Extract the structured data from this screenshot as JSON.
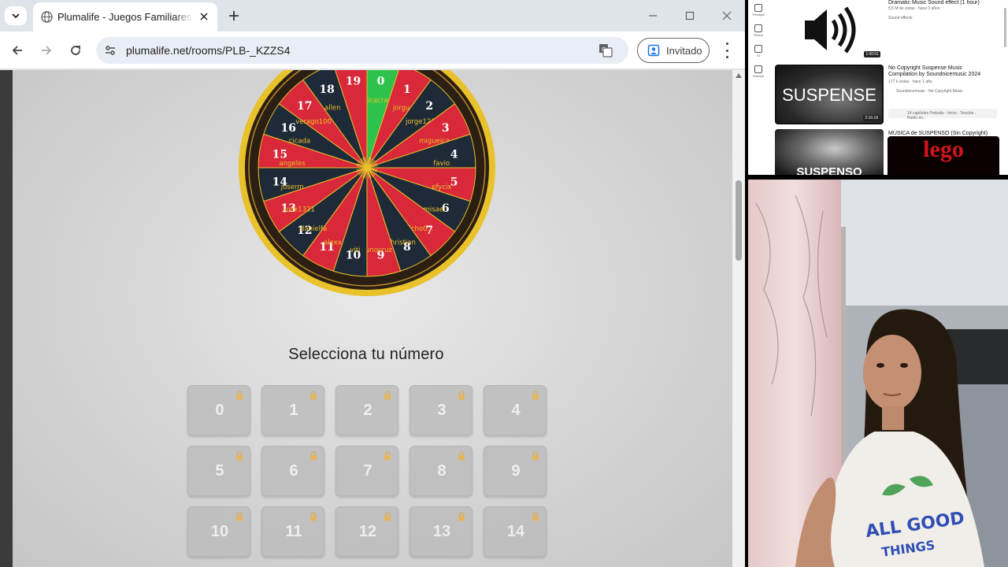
{
  "browser": {
    "tab_title": "Plumalife - Juegos Familiares a distancia",
    "url": "plumalife.net/rooms/PLB-_KZZS4",
    "profile_label": "Invitado"
  },
  "page": {
    "select_title": "Selecciona tu número",
    "wheel": {
      "segments": [
        {
          "n": "0",
          "name": "monicacraniotu",
          "color": "green"
        },
        {
          "n": "1",
          "name": "jorgu",
          "color": "red"
        },
        {
          "n": "2",
          "name": "jorge123",
          "color": "dark"
        },
        {
          "n": "3",
          "name": "migueica",
          "color": "red"
        },
        {
          "n": "4",
          "name": "favio",
          "color": "dark"
        },
        {
          "n": "5",
          "name": "efycix",
          "color": "red"
        },
        {
          "n": "6",
          "name": "misael",
          "color": "dark"
        },
        {
          "n": "7",
          "name": "jicho0...",
          "color": "red"
        },
        {
          "n": "8",
          "name": "christian",
          "color": "dark"
        },
        {
          "n": "9",
          "name": "unocruz",
          "color": "red"
        },
        {
          "n": "10",
          "name": "viti",
          "color": "dark"
        },
        {
          "n": "11",
          "name": "alexx",
          "color": "red"
        },
        {
          "n": "12",
          "name": "danielfa",
          "color": "dark"
        },
        {
          "n": "13",
          "name": "jose1321",
          "color": "red"
        },
        {
          "n": "14",
          "name": "joserm",
          "color": "dark"
        },
        {
          "n": "15",
          "name": "angeles",
          "color": "red"
        },
        {
          "n": "16",
          "name": "cicada",
          "color": "dark"
        },
        {
          "n": "17",
          "name": "verago100",
          "color": "red"
        },
        {
          "n": "18",
          "name": "allen",
          "color": "dark"
        },
        {
          "n": "19",
          "name": "",
          "color": "red"
        }
      ]
    },
    "numbers": [
      "0",
      "1",
      "2",
      "3",
      "4",
      "5",
      "6",
      "7",
      "8",
      "9",
      "10",
      "11",
      "12",
      "13",
      "14"
    ]
  },
  "youtube": {
    "items": [
      {
        "title": "Dramatic Music Sound effect (1 hour)",
        "meta": "5,5 M de vistas · hace 3 años",
        "channel": "Sound effects",
        "thumb_text": "",
        "duration": "1:00:01"
      },
      {
        "title": "No Copyright Suspense Music Compilation by Soundnicemusic 2024",
        "meta": "177 k vistas · hace 1 año",
        "channel": "Soundnicemusic · No Copyright Music",
        "thumb_text": "SUSPENSE",
        "duration": "2:16:18"
      },
      {
        "title": "MÚSICA de SUSPENSO (Sin Copyright)",
        "meta": "",
        "channel": "",
        "thumb_text": "SUSPENSO",
        "duration": ""
      },
      {
        "title": "",
        "meta": "",
        "channel": "",
        "thumb_text": "lego",
        "duration": ""
      }
    ],
    "chapters_label": "14 capítulos  Preludio · Inicio · Tensión · Ruido en...",
    "sidebar": [
      "Principal",
      "Shorts",
      "Tú",
      "Historial"
    ]
  },
  "colors": {
    "wheel_red": "#d8283a",
    "wheel_dark": "#1f2a38",
    "wheel_green": "#2fc24a",
    "wheel_gold": "#e9c12a",
    "button_gray": "#bdbdbd"
  }
}
